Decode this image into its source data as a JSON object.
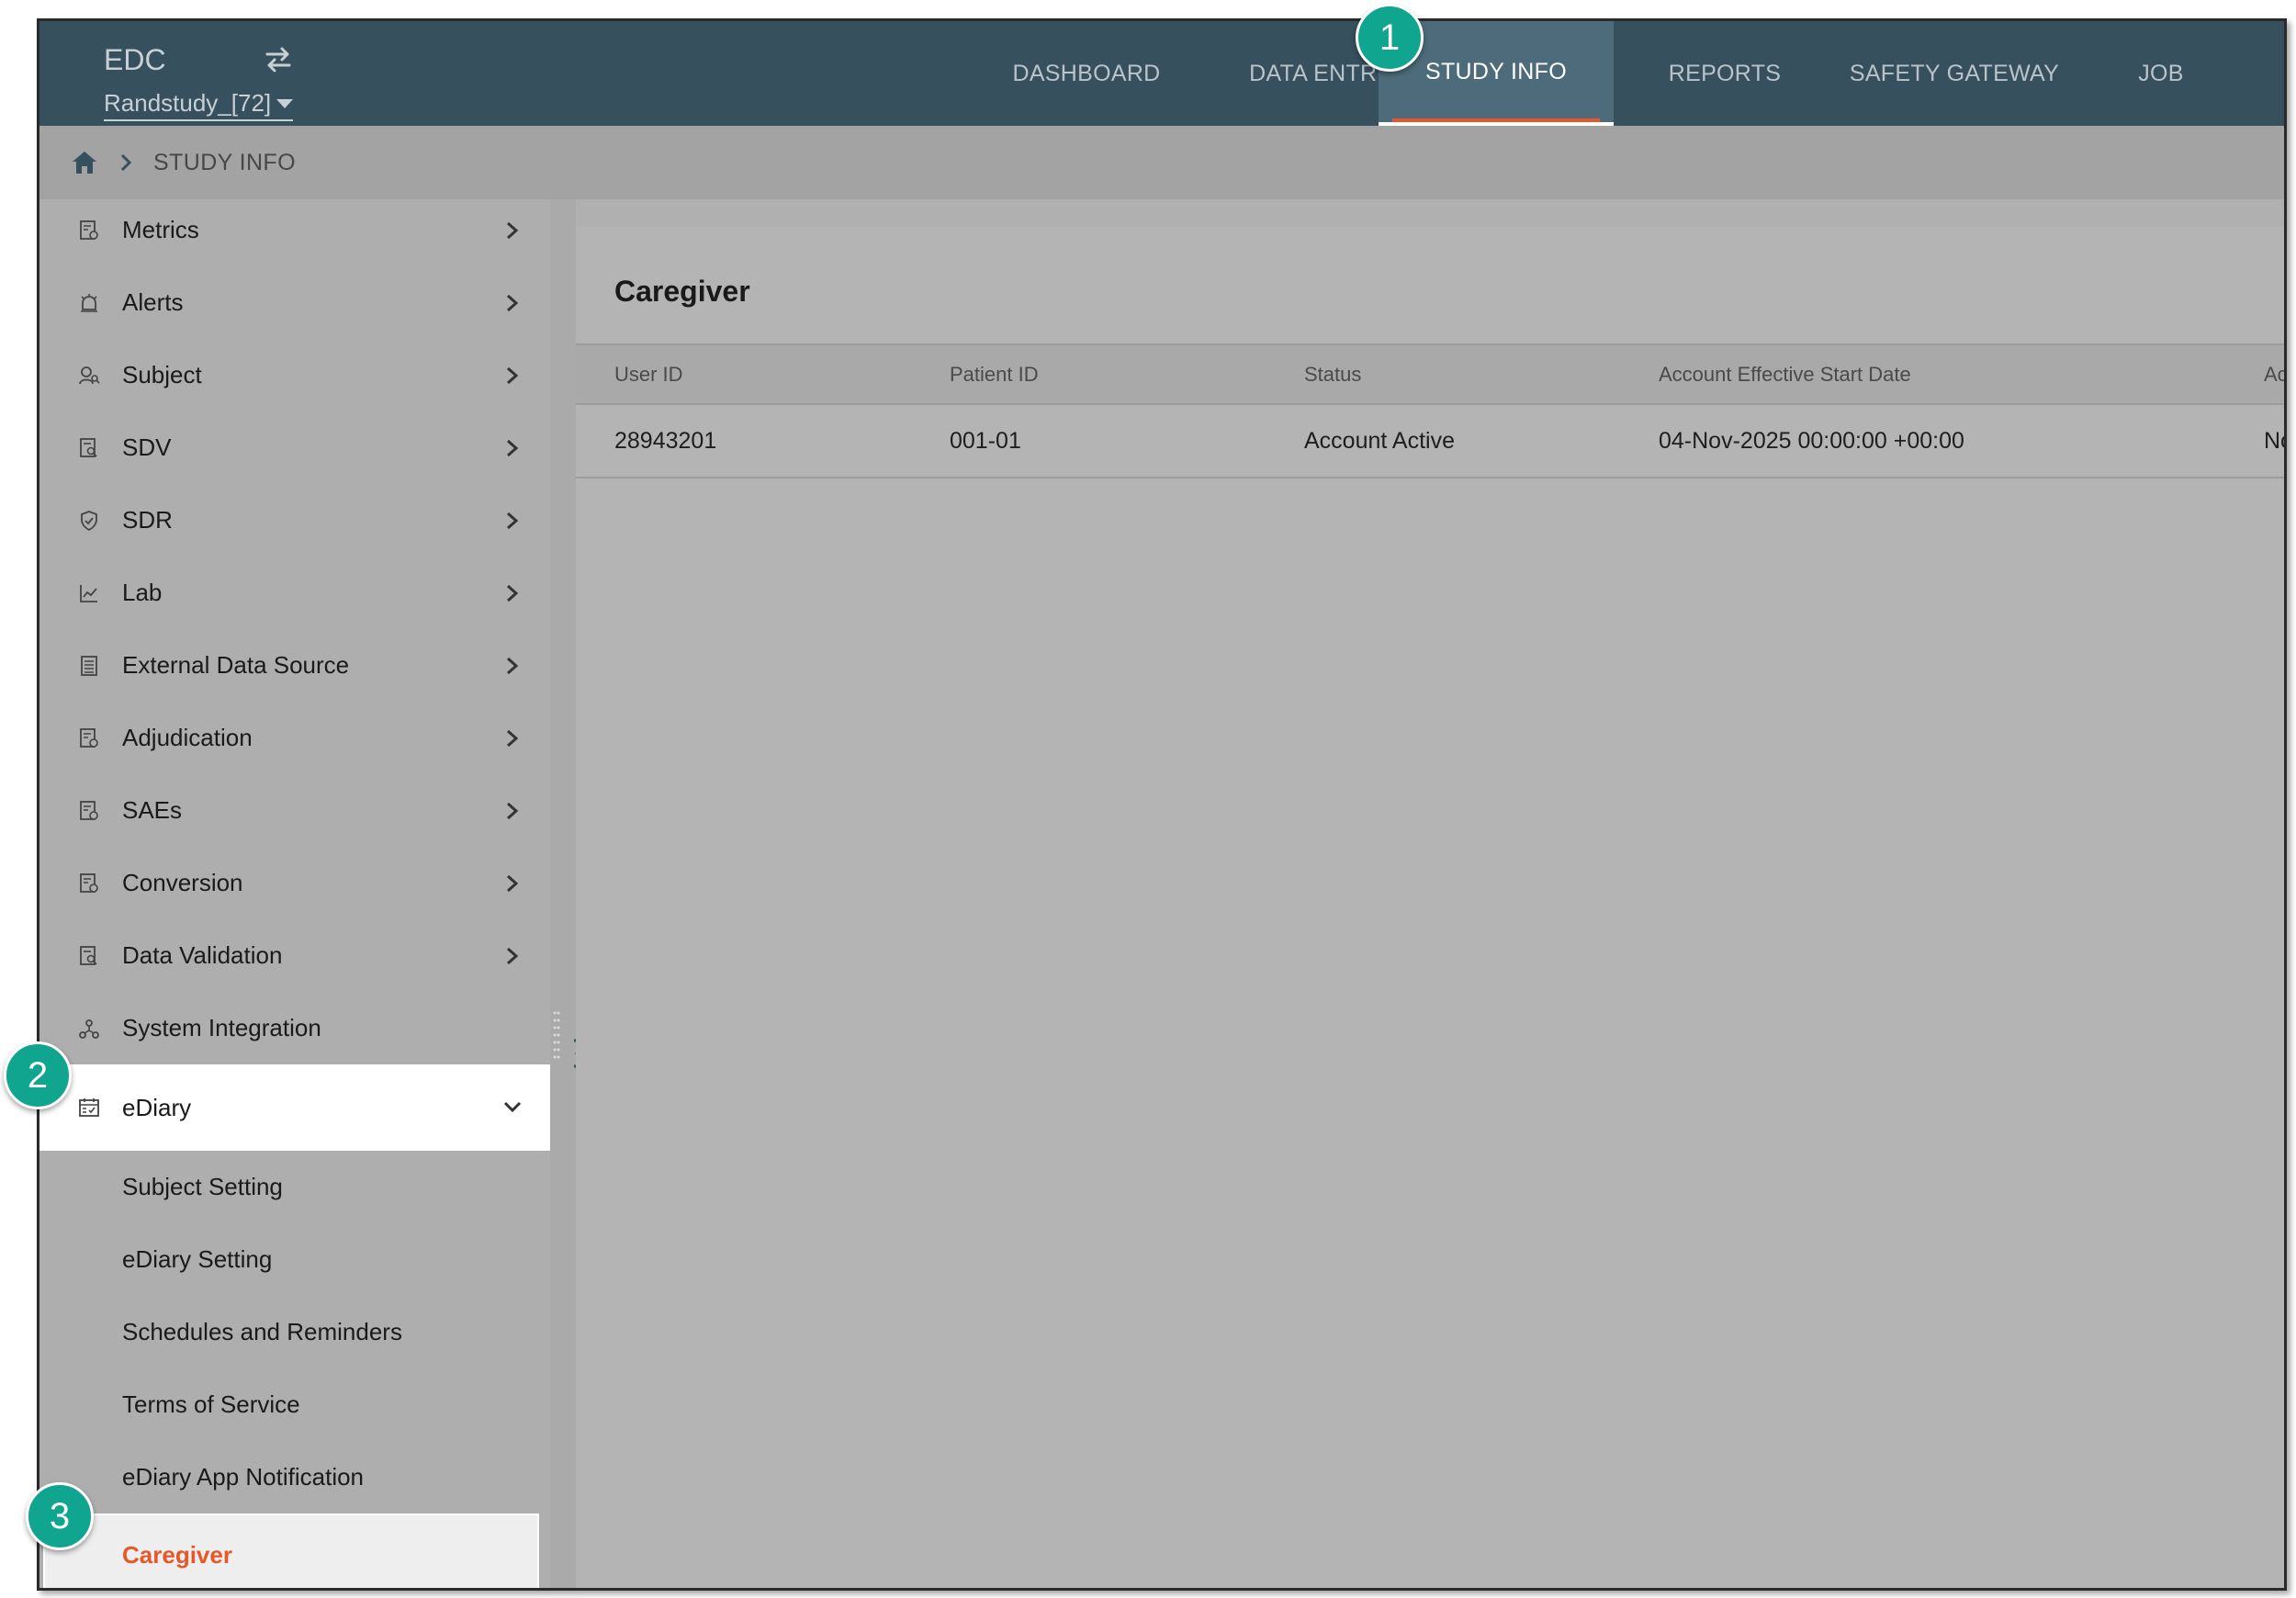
{
  "app": {
    "title": "EDC",
    "study_selector": "Randstudy_[72]"
  },
  "nav": {
    "tabs": [
      {
        "label": "DASHBOARD",
        "active": false
      },
      {
        "label": "DATA ENTRY",
        "active": false
      },
      {
        "label": "STUDY INFO",
        "active": true
      },
      {
        "label": "REPORTS",
        "active": false
      },
      {
        "label": "SAFETY GATEWAY",
        "active": false
      },
      {
        "label": "JOB",
        "active": false
      }
    ]
  },
  "breadcrumb": {
    "current": "STUDY INFO"
  },
  "sidebar": {
    "items": [
      {
        "label": "Metrics",
        "icon": "report-icon"
      },
      {
        "label": "Alerts",
        "icon": "alarm-icon"
      },
      {
        "label": "Subject",
        "icon": "person-search-icon"
      },
      {
        "label": "SDV",
        "icon": "doc-search-icon"
      },
      {
        "label": "SDR",
        "icon": "shield-check-icon"
      },
      {
        "label": "Lab",
        "icon": "line-chart-icon"
      },
      {
        "label": "External Data Source",
        "icon": "list-doc-icon"
      },
      {
        "label": "Adjudication",
        "icon": "report-icon"
      },
      {
        "label": "SAEs",
        "icon": "report-icon"
      },
      {
        "label": "Conversion",
        "icon": "report-icon"
      },
      {
        "label": "Data Validation",
        "icon": "doc-search-icon"
      },
      {
        "label": "System Integration",
        "icon": "hub-icon"
      },
      {
        "label": "eDiary",
        "icon": "calendar-check-icon"
      }
    ],
    "ediary_subitems": [
      {
        "label": "Subject Setting"
      },
      {
        "label": "eDiary Setting"
      },
      {
        "label": "Schedules and Reminders"
      },
      {
        "label": "Terms of Service"
      },
      {
        "label": "eDiary App Notification"
      },
      {
        "label": "Caregiver"
      }
    ]
  },
  "main": {
    "title": "Caregiver",
    "table": {
      "columns": [
        "User ID",
        "Patient ID",
        "Status",
        "Account Effective Start Date",
        "Acco"
      ],
      "rows": [
        [
          "28943201",
          "001-01",
          "Account Active",
          "04-Nov-2025 00:00:00 +00:00",
          "No E"
        ]
      ]
    }
  },
  "badges": [
    "1",
    "2",
    "3"
  ],
  "colors": {
    "topbar": "#37505e",
    "active_tab": "#4e6b7b",
    "accent": "#e8572a",
    "badge": "#0fa58f"
  }
}
